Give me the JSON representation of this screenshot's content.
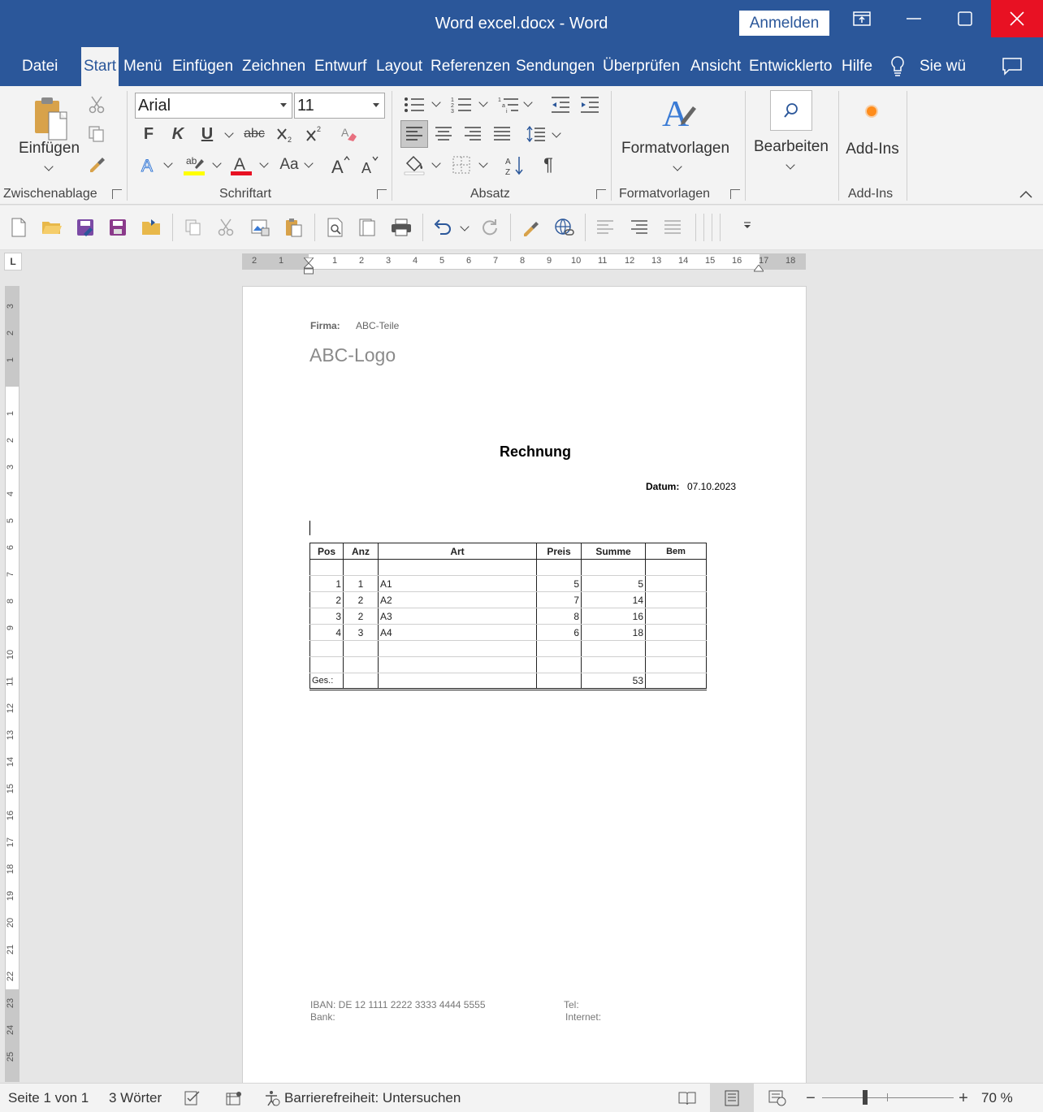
{
  "window": {
    "title": "Word excel.docx  -  Word",
    "signin_label": "Anmelden"
  },
  "tabs": [
    "Datei",
    "Start",
    "Menü",
    "Einfügen",
    "Zeichnen",
    "Entwurf",
    "Layout",
    "Referenzen",
    "Sendungen",
    "Überprüfen",
    "Ansicht",
    "Entwicklerto",
    "Hilfe"
  ],
  "tell_me": "Sie wü",
  "ribbon": {
    "clipboard": {
      "paste_label": "Einfügen",
      "group_label": "Zwischenablage"
    },
    "font": {
      "font_name": "Arial",
      "font_size": "11",
      "bold": "F",
      "italic": "K",
      "underline": "U",
      "strike": "abc",
      "group_label": "Schriftart"
    },
    "paragraph": {
      "group_label": "Absatz"
    },
    "styles": {
      "label": "Formatvorlagen",
      "group_label": "Formatvorlagen"
    },
    "edit": {
      "label": "Bearbeiten"
    },
    "addins": {
      "label": "Add-Ins",
      "group_label": "Add-Ins"
    }
  },
  "ruler": {
    "h_left": [
      "2",
      "1"
    ],
    "h_right": [
      "1",
      "2",
      "3",
      "4",
      "5",
      "6",
      "7",
      "8",
      "9",
      "10",
      "11",
      "12",
      "13",
      "14",
      "15",
      "16",
      "17",
      "18"
    ],
    "v_top": [
      "3",
      "2",
      "1"
    ],
    "v_bottom": [
      "1",
      "2",
      "3",
      "4",
      "5",
      "6",
      "7",
      "8",
      "9",
      "10",
      "11",
      "12",
      "13",
      "14",
      "15",
      "16",
      "17",
      "18",
      "19",
      "20",
      "21",
      "22",
      "23",
      "24",
      "25"
    ]
  },
  "document": {
    "firma_label": "Firma:",
    "firma_value": "ABC-Teile",
    "logo": "ABC-Logo",
    "heading": "Rechnung",
    "datum_label": "Datum:",
    "datum_value": "07.10.2023",
    "table": {
      "headers": [
        "Pos",
        "Anz",
        "Art",
        "Preis",
        "Summe",
        "Bem"
      ],
      "rows": [
        [
          "1",
          "1",
          "A1",
          "5",
          "5",
          ""
        ],
        [
          "2",
          "2",
          "A2",
          "7",
          "14",
          ""
        ],
        [
          "3",
          "2",
          "A3",
          "8",
          "16",
          ""
        ],
        [
          "4",
          "3",
          "A4",
          "6",
          "18",
          ""
        ]
      ],
      "total_label": "Ges.:",
      "total_value": "53"
    },
    "footer": {
      "iban": "IBAN: DE 12 1111 2222 3333 4444 5555",
      "bank": "Bank:",
      "tel": "Tel:",
      "internet": "Internet:"
    }
  },
  "status": {
    "page": "Seite 1 von 1",
    "words": "3 Wörter",
    "accessibility": "Barrierefreiheit: Untersuchen",
    "zoom": "70 %",
    "zoom_level": 0.7
  },
  "colors": {
    "title_bar": "#2b579a",
    "close_button": "#e81123",
    "font_color_bar": "#e81123",
    "highlight_bar": "#ffff00",
    "accent_text": "#2b579a"
  }
}
